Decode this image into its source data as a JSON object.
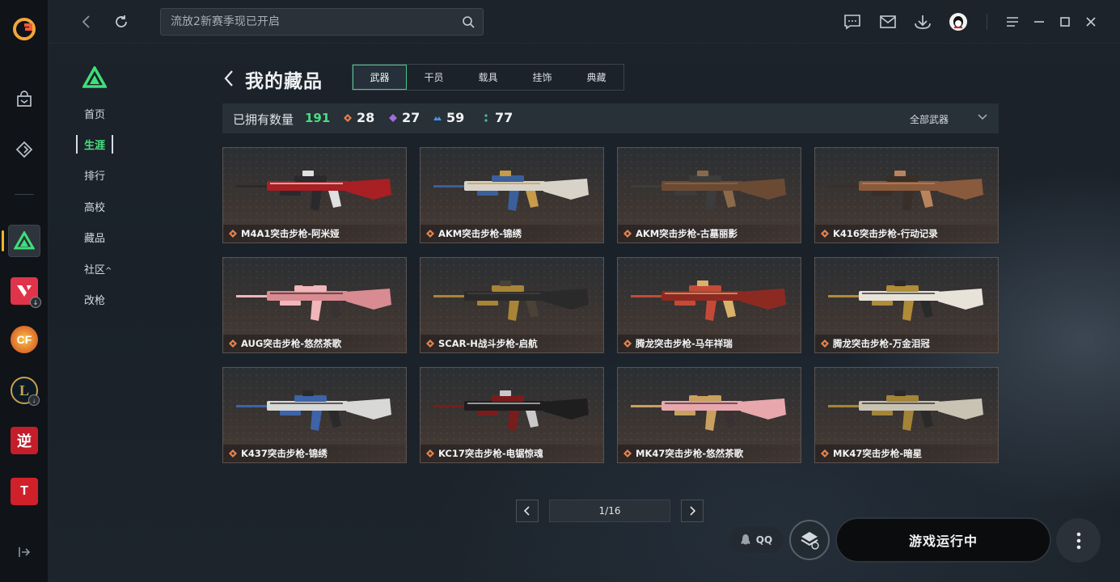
{
  "topbar": {
    "search_placeholder": "流放2新赛季现已开启",
    "qq_label": "QQ"
  },
  "rail": {
    "games": [
      "valorant",
      "crossfire",
      "league-of-legends",
      "nishuihan",
      "tiantang"
    ]
  },
  "subnav": {
    "items": [
      {
        "label": "首页"
      },
      {
        "label": "生涯",
        "active": true
      },
      {
        "label": "排行"
      },
      {
        "label": "高校"
      },
      {
        "label": "藏品"
      },
      {
        "label": "社区",
        "suffix": "^"
      },
      {
        "label": "改枪"
      }
    ]
  },
  "main": {
    "title": "我的藏品",
    "tabs": [
      "武器",
      "干员",
      "载具",
      "挂饰",
      "典藏"
    ],
    "active_tab": "武器",
    "stats": {
      "owned_label": "已拥有数量",
      "owned_total": "191",
      "tiers": [
        {
          "value": "28",
          "color": "#e7834b"
        },
        {
          "value": "27",
          "color": "#a36bdc"
        },
        {
          "value": "59",
          "color": "#4a90e2"
        },
        {
          "value": "77",
          "color": "#44c39a"
        }
      ],
      "filter_label": "全部武器"
    },
    "items": [
      {
        "name": "M4A1突击步枪-阿米娅",
        "palette": [
          "#a81f24",
          "#2a2a2e",
          "#e0e0e0"
        ]
      },
      {
        "name": "AKM突击步枪-锦绣",
        "palette": [
          "#d8d3c8",
          "#3a5f9b",
          "#c79b4a"
        ]
      },
      {
        "name": "AKM突击步枪-古墓丽影",
        "palette": [
          "#6b4a34",
          "#3c3c3c",
          "#8a6a4a"
        ]
      },
      {
        "name": "K416突击步枪-行动记录",
        "palette": [
          "#8a5a3c",
          "#3a2e28",
          "#b9845c"
        ]
      },
      {
        "name": "AUG突击步枪-悠然茶歌",
        "palette": [
          "#d98b92",
          "#f0b6b9",
          "#3a3232"
        ]
      },
      {
        "name": "SCAR-H战斗步枪-启航",
        "palette": [
          "#2a2a2a",
          "#a88436",
          "#4a4236"
        ]
      },
      {
        "name": "腾龙突击步枪-马年祥瑞",
        "palette": [
          "#8c2a22",
          "#c44a38",
          "#d8b16a"
        ]
      },
      {
        "name": "腾龙突击步枪-万金泪冠",
        "palette": [
          "#e8e3d9",
          "#b08b38",
          "#2a2a2a"
        ]
      },
      {
        "name": "K437突击步枪-锦绣",
        "palette": [
          "#d8d8d6",
          "#3d63a8",
          "#2a2a2a"
        ]
      },
      {
        "name": "KC17突击步枪-电锯惊魂",
        "palette": [
          "#1e1e1e",
          "#7a1c1c",
          "#c9c9c9"
        ]
      },
      {
        "name": "MK47突击步枪-悠然茶歌",
        "palette": [
          "#e7a7ad",
          "#caa060",
          "#3a3232"
        ]
      },
      {
        "name": "MK47突击步枪-暗星",
        "palette": [
          "#c9c3b3",
          "#a48537",
          "#2a2a2a"
        ]
      }
    ],
    "pager": {
      "text": "1/16"
    }
  },
  "bottom": {
    "run_label": "游戏运行中"
  }
}
